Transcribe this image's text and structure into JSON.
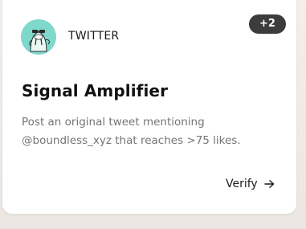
{
  "card": {
    "source": "TWITTER",
    "badge": "+2",
    "title": "Signal Amplifier",
    "description": "Post an original tweet mentioning @boundless_xyz that reaches >75 likes.",
    "verify_label": "Verify",
    "avatar_icon": "walrus-mascot-icon",
    "arrow_icon": "arrow-right-icon"
  },
  "colors": {
    "avatar_bg": "#7fd8cc",
    "badge_bg": "#3c3c3c",
    "description": "#757575"
  }
}
